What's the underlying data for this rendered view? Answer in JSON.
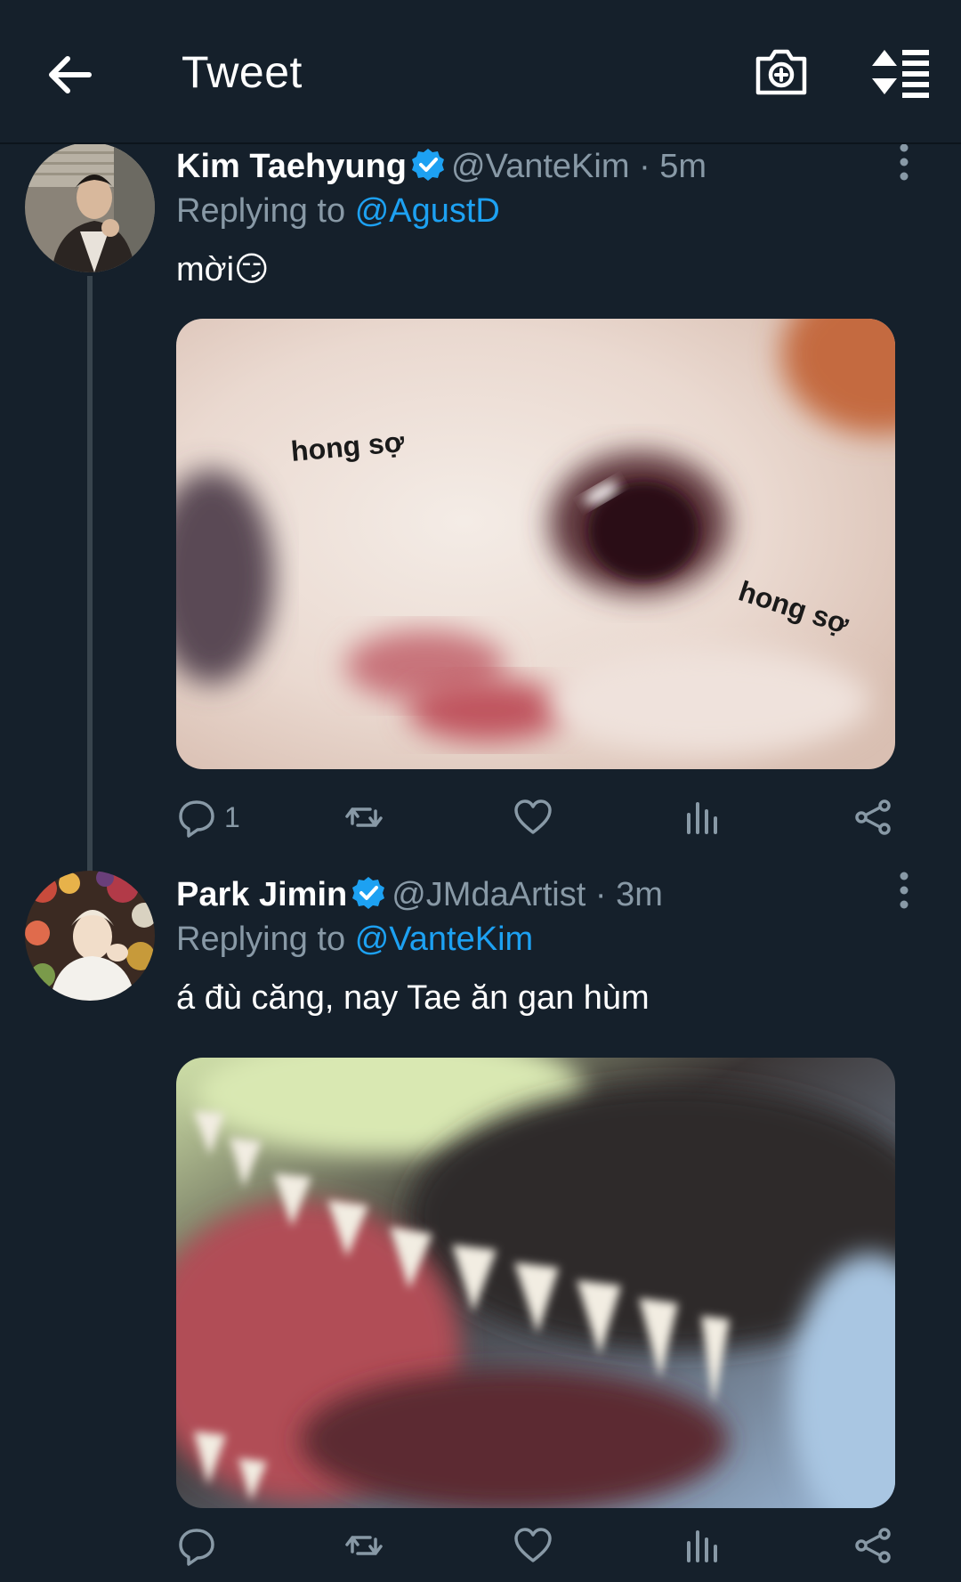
{
  "header": {
    "title": "Tweet"
  },
  "icons": {
    "back": "arrow-left-icon",
    "camera": "camera-add-icon",
    "sort": "sort-icon",
    "verified": "verified-badge-icon",
    "more": "more-vertical-icon",
    "reply": "reply-icon",
    "retweet": "retweet-icon",
    "like": "heart-icon",
    "analytics": "analytics-icon",
    "share": "share-icon"
  },
  "colors": {
    "background": "#15202b",
    "accent": "#1da1f2",
    "muted": "#8899a6"
  },
  "tweets": [
    {
      "name": "Kim Taehyung",
      "handle": "@VanteKim",
      "sep": "·",
      "time": "5m",
      "replying_label": "Replying to",
      "replying_to": "@AgustD",
      "text": "mời😏",
      "media_captions": [
        "hong sợ",
        "hong sợ"
      ],
      "reply_count": "1"
    },
    {
      "name": "Park Jimin",
      "handle": "@JMdaArtist",
      "sep": "·",
      "time": "3m",
      "replying_label": "Replying to",
      "replying_to": "@VanteKim",
      "text": "á đù căng, nay Tae ăn gan hùm",
      "reply_count": ""
    }
  ]
}
